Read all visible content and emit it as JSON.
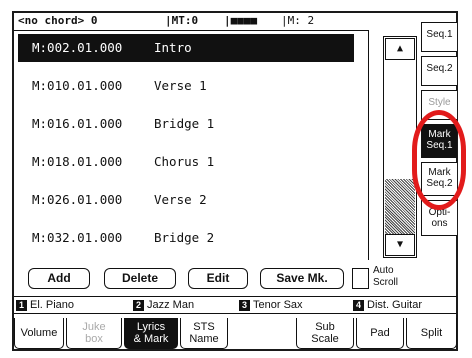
{
  "status": {
    "chord": "<no chord> 0",
    "mt": "|MT:0",
    "bars": "|■■■■",
    "measure": "|M:  2"
  },
  "list": {
    "rows": [
      {
        "loc": "M:002.01.000",
        "name": "Intro",
        "selected": true
      },
      {
        "loc": "M:010.01.000",
        "name": "Verse 1",
        "selected": false
      },
      {
        "loc": "M:016.01.000",
        "name": "Bridge 1",
        "selected": false
      },
      {
        "loc": "M:018.01.000",
        "name": "Chorus 1",
        "selected": false
      },
      {
        "loc": "M:026.01.000",
        "name": "Verse 2",
        "selected": false
      },
      {
        "loc": "M:032.01.000",
        "name": "Bridge 2",
        "selected": false
      }
    ]
  },
  "scroll": {
    "up": "▲",
    "down": "▼"
  },
  "side_tabs": {
    "seq1": "Seq.1",
    "seq2": "Seq.2",
    "style": "Style",
    "mark_seq1": "Mark\nSeq.1",
    "mark_seq2": "Mark\nSeq.2",
    "options": "Opti-\nons"
  },
  "buttons": {
    "add": "Add",
    "delete": "Delete",
    "edit": "Edit",
    "save_mk": "Save Mk.",
    "auto_scroll": "Auto\nScroll"
  },
  "tracks": [
    {
      "num": "1",
      "name": "El. Piano"
    },
    {
      "num": "2",
      "name": "Jazz Man"
    },
    {
      "num": "3",
      "name": "Tenor Sax"
    },
    {
      "num": "4",
      "name": "Dist. Guitar"
    }
  ],
  "bottom_tabs": {
    "volume": "Volume",
    "jukebox": "Juke\nbox",
    "lyrics_mark": "Lyrics\n& Mark",
    "sts_name": "STS\nName",
    "sub_scale": "Sub\nScale",
    "pad": "Pad",
    "split": "Split"
  },
  "colors": {
    "highlight_circle": "#e21b1b",
    "lcd_ink": "#111111"
  }
}
